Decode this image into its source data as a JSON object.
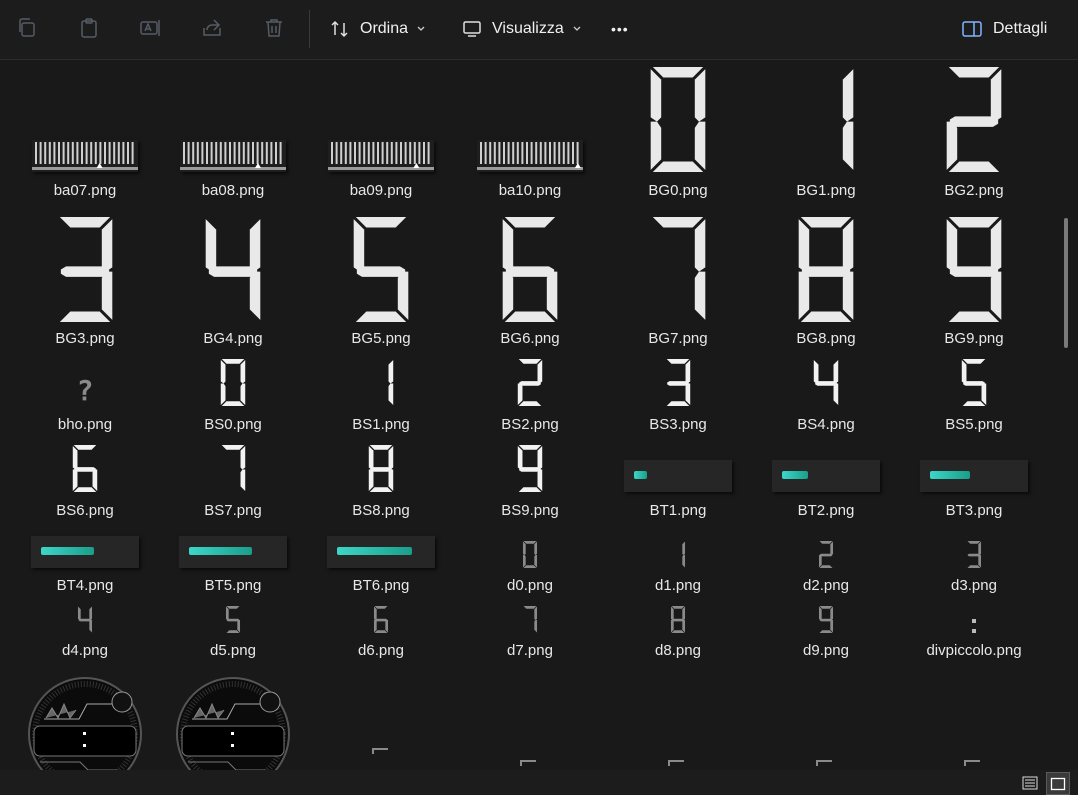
{
  "toolbar": {
    "sort_label": "Ordina",
    "view_label": "Visualizza",
    "more_label": "•••",
    "details_label": "Dettagli",
    "icons": [
      "copy-icon",
      "paste-icon",
      "rename-icon",
      "share-icon",
      "delete-icon"
    ]
  },
  "files": [
    {
      "name": "ba07.png",
      "kind": "ruler",
      "level": 0.65
    },
    {
      "name": "ba08.png",
      "kind": "ruler",
      "level": 0.75
    },
    {
      "name": "ba09.png",
      "kind": "ruler",
      "level": 0.85
    },
    {
      "name": "ba10.png",
      "kind": "ruler",
      "level": 0.97
    },
    {
      "name": "BG0.png",
      "kind": "big",
      "digit": "0"
    },
    {
      "name": "BG1.png",
      "kind": "big",
      "digit": "1"
    },
    {
      "name": "BG2.png",
      "kind": "big",
      "digit": "2"
    },
    {
      "name": "BG3.png",
      "kind": "big",
      "digit": "3"
    },
    {
      "name": "BG4.png",
      "kind": "big",
      "digit": "4"
    },
    {
      "name": "BG5.png",
      "kind": "big",
      "digit": "5"
    },
    {
      "name": "BG6.png",
      "kind": "big",
      "digit": "6"
    },
    {
      "name": "BG7.png",
      "kind": "big",
      "digit": "7"
    },
    {
      "name": "BG8.png",
      "kind": "big",
      "digit": "8"
    },
    {
      "name": "BG9.png",
      "kind": "big",
      "digit": "9"
    },
    {
      "name": "bho.png",
      "kind": "question"
    },
    {
      "name": "BS0.png",
      "kind": "small",
      "digit": "0"
    },
    {
      "name": "BS1.png",
      "kind": "small",
      "digit": "1"
    },
    {
      "name": "BS2.png",
      "kind": "small",
      "digit": "2"
    },
    {
      "name": "BS3.png",
      "kind": "small",
      "digit": "3"
    },
    {
      "name": "BS4.png",
      "kind": "small",
      "digit": "4"
    },
    {
      "name": "BS5.png",
      "kind": "small",
      "digit": "5"
    },
    {
      "name": "BS6.png",
      "kind": "small",
      "digit": "6"
    },
    {
      "name": "BS7.png",
      "kind": "small",
      "digit": "7"
    },
    {
      "name": "BS8.png",
      "kind": "small",
      "digit": "8"
    },
    {
      "name": "BS9.png",
      "kind": "small",
      "digit": "9"
    },
    {
      "name": "BT1.png",
      "kind": "bar",
      "level": 0.15
    },
    {
      "name": "BT2.png",
      "kind": "bar",
      "level": 0.3
    },
    {
      "name": "BT3.png",
      "kind": "bar",
      "level": 0.45
    },
    {
      "name": "BT4.png",
      "kind": "bar",
      "level": 0.6
    },
    {
      "name": "BT5.png",
      "kind": "bar",
      "level": 0.72
    },
    {
      "name": "BT6.png",
      "kind": "bar",
      "level": 0.85
    },
    {
      "name": "d0.png",
      "kind": "tiny",
      "digit": "0"
    },
    {
      "name": "d1.png",
      "kind": "tiny",
      "digit": "1"
    },
    {
      "name": "d2.png",
      "kind": "tiny",
      "digit": "2"
    },
    {
      "name": "d3.png",
      "kind": "tiny",
      "digit": "3"
    },
    {
      "name": "d4.png",
      "kind": "tiny",
      "digit": "4"
    },
    {
      "name": "d5.png",
      "kind": "tiny",
      "digit": "5"
    },
    {
      "name": "d6.png",
      "kind": "tiny",
      "digit": "6"
    },
    {
      "name": "d7.png",
      "kind": "tiny",
      "digit": "7"
    },
    {
      "name": "d8.png",
      "kind": "tiny",
      "digit": "8"
    },
    {
      "name": "d9.png",
      "kind": "tiny",
      "digit": "9"
    },
    {
      "name": "divpiccolo.png",
      "kind": "colon"
    },
    {
      "name": "",
      "kind": "watch"
    },
    {
      "name": "",
      "kind": "watch"
    }
  ],
  "colors": {
    "background": "#191919",
    "toolbar": "#1c1c1c",
    "bar_fill": "#2ec4b6"
  }
}
